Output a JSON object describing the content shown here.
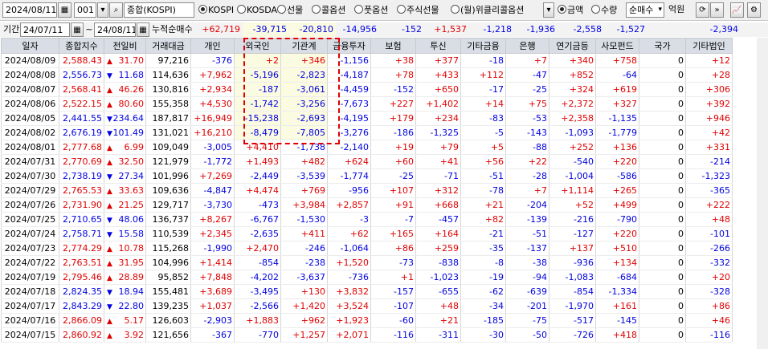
{
  "toolbar": {
    "date": "2024/08/11",
    "code": "001",
    "index_name": "종합(KOSPI)",
    "markets": [
      {
        "label": "KOSPI",
        "selected": true
      },
      {
        "label": "KOSDAQ",
        "selected": false
      },
      {
        "label": "선물",
        "selected": false
      },
      {
        "label": "콜옵션",
        "selected": false
      },
      {
        "label": "풋옵션",
        "selected": false
      },
      {
        "label": "주식선물",
        "selected": false
      },
      {
        "label": "(월)위클리콜옵션",
        "selected": false
      }
    ],
    "units": [
      {
        "label": "금액",
        "selected": true
      },
      {
        "label": "수량",
        "selected": false
      }
    ],
    "mode": "순매수",
    "unit_text": "억원"
  },
  "period": {
    "label": "기간",
    "from": "24/07/11",
    "sep": "~",
    "to": "24/08/11",
    "cum_label": "누적순매수",
    "cum_values": [
      "+62,719",
      "-39,715",
      "-20,810",
      "-14,956",
      "-152",
      "+1,537",
      "-1,218",
      "-1,936",
      "-2,558",
      "-1,527",
      "",
      "-2,394"
    ]
  },
  "columns": [
    "일자",
    "종합지수",
    "전일비",
    "거래대금",
    "개인",
    "외국인",
    "기관계",
    "금융투자",
    "보험",
    "투신",
    "기타금융",
    "은행",
    "연기금등",
    "사모펀드",
    "국가",
    "기타법인"
  ],
  "rows": [
    [
      "2024/08/09",
      "2,588.43",
      "31.70",
      "97,216",
      "-376",
      "+2",
      "+346",
      "-1,156",
      "+38",
      "+377",
      "-18",
      "+7",
      "+340",
      "+758",
      "0",
      "+12"
    ],
    [
      "2024/08/08",
      "2,556.73",
      "11.68",
      "114,636",
      "+7,962",
      "-5,196",
      "-2,823",
      "-4,187",
      "+78",
      "+433",
      "+112",
      "-47",
      "+852",
      "-64",
      "0",
      "+28"
    ],
    [
      "2024/08/07",
      "2,568.41",
      "46.26",
      "130,816",
      "+2,934",
      "-187",
      "-3,061",
      "-4,459",
      "-152",
      "+650",
      "-17",
      "-25",
      "+324",
      "+619",
      "0",
      "+306"
    ],
    [
      "2024/08/06",
      "2,522.15",
      "80.60",
      "155,358",
      "+4,530",
      "-1,742",
      "-3,256",
      "-7,673",
      "+227",
      "+1,402",
      "+14",
      "+75",
      "+2,372",
      "+327",
      "0",
      "+392"
    ],
    [
      "2024/08/05",
      "2,441.55",
      "234.64",
      "187,817",
      "+16,949",
      "-15,238",
      "-2,693",
      "-4,195",
      "+179",
      "+234",
      "-83",
      "-53",
      "+2,358",
      "-1,135",
      "0",
      "+946"
    ],
    [
      "2024/08/02",
      "2,676.19",
      "101.49",
      "131,021",
      "+16,210",
      "-8,479",
      "-7,805",
      "-3,276",
      "-186",
      "-1,325",
      "-5",
      "-143",
      "-1,093",
      "-1,779",
      "0",
      "+42"
    ],
    [
      "2024/08/01",
      "2,777.68",
      "6.99",
      "109,049",
      "-3,005",
      "+4,410",
      "-1,738",
      "-2,140",
      "+19",
      "+79",
      "+5",
      "-88",
      "+252",
      "+136",
      "0",
      "+331"
    ],
    [
      "2024/07/31",
      "2,770.69",
      "32.50",
      "121,979",
      "-1,772",
      "+1,493",
      "+482",
      "+624",
      "+60",
      "+41",
      "+56",
      "+22",
      "-540",
      "+220",
      "0",
      "-214"
    ],
    [
      "2024/07/30",
      "2,738.19",
      "27.34",
      "101,996",
      "+7,269",
      "-2,449",
      "-3,539",
      "-1,774",
      "-25",
      "-71",
      "-51",
      "-28",
      "-1,004",
      "-586",
      "0",
      "-1,323"
    ],
    [
      "2024/07/29",
      "2,765.53",
      "33.63",
      "109,636",
      "-4,847",
      "+4,474",
      "+769",
      "-956",
      "+107",
      "+312",
      "-78",
      "+7",
      "+1,114",
      "+265",
      "0",
      "-365"
    ],
    [
      "2024/07/26",
      "2,731.90",
      "21.25",
      "129,717",
      "-3,730",
      "-473",
      "+3,984",
      "+2,857",
      "+91",
      "+668",
      "+21",
      "-204",
      "+52",
      "+499",
      "0",
      "+222"
    ],
    [
      "2024/07/25",
      "2,710.65",
      "48.06",
      "136,737",
      "+8,267",
      "-6,767",
      "-1,530",
      "-3",
      "-7",
      "-457",
      "+82",
      "-139",
      "-216",
      "-790",
      "0",
      "+48"
    ],
    [
      "2024/07/24",
      "2,758.71",
      "15.58",
      "110,539",
      "+2,345",
      "-2,635",
      "+411",
      "+62",
      "+165",
      "+164",
      "-21",
      "-51",
      "-127",
      "+220",
      "0",
      "-101"
    ],
    [
      "2024/07/23",
      "2,774.29",
      "10.78",
      "115,268",
      "-1,990",
      "+2,470",
      "-246",
      "-1,064",
      "+86",
      "+259",
      "-35",
      "-137",
      "+137",
      "+510",
      "0",
      "-266"
    ],
    [
      "2024/07/22",
      "2,763.51",
      "31.95",
      "104,996",
      "+1,414",
      "-854",
      "-238",
      "+1,520",
      "-73",
      "-838",
      "-8",
      "-38",
      "-936",
      "+134",
      "0",
      "-332"
    ],
    [
      "2024/07/19",
      "2,795.46",
      "28.89",
      "95,852",
      "+7,848",
      "-4,202",
      "-3,637",
      "-736",
      "+1",
      "-1,023",
      "-19",
      "-94",
      "-1,083",
      "-684",
      "0",
      "+20"
    ],
    [
      "2024/07/18",
      "2,824.35",
      "18.94",
      "155,481",
      "+3,689",
      "-3,495",
      "+130",
      "+3,832",
      "-157",
      "-655",
      "-62",
      "-639",
      "-854",
      "-1,334",
      "0",
      "-328"
    ],
    [
      "2024/07/17",
      "2,843.29",
      "22.80",
      "139,235",
      "+1,037",
      "-2,566",
      "+1,420",
      "+3,524",
      "-107",
      "+48",
      "-34",
      "-201",
      "-1,970",
      "+161",
      "0",
      "+86"
    ],
    [
      "2024/07/16",
      "2,866.09",
      "5.17",
      "126,603",
      "-2,903",
      "+1,883",
      "+962",
      "+1,923",
      "-60",
      "+21",
      "-185",
      "-75",
      "-517",
      "-145",
      "0",
      "+46"
    ],
    [
      "2024/07/15",
      "2,860.92",
      "3.92",
      "121,656",
      "-367",
      "-770",
      "+1,257",
      "+2,071",
      "-116",
      "-311",
      "-30",
      "-50",
      "-726",
      "+418",
      "0",
      "-116"
    ]
  ],
  "change_dir": [
    "up",
    "down",
    "up",
    "up",
    "down",
    "down",
    "up",
    "up",
    "down",
    "up",
    "up",
    "down",
    "down",
    "up",
    "up",
    "up",
    "down",
    "down",
    "up",
    "up"
  ],
  "arrows": {
    "up": "▲",
    "down": "▼"
  },
  "colors": {
    "up": "#e00000",
    "down": "#0000e0",
    "highlight_border": "#e00000"
  }
}
